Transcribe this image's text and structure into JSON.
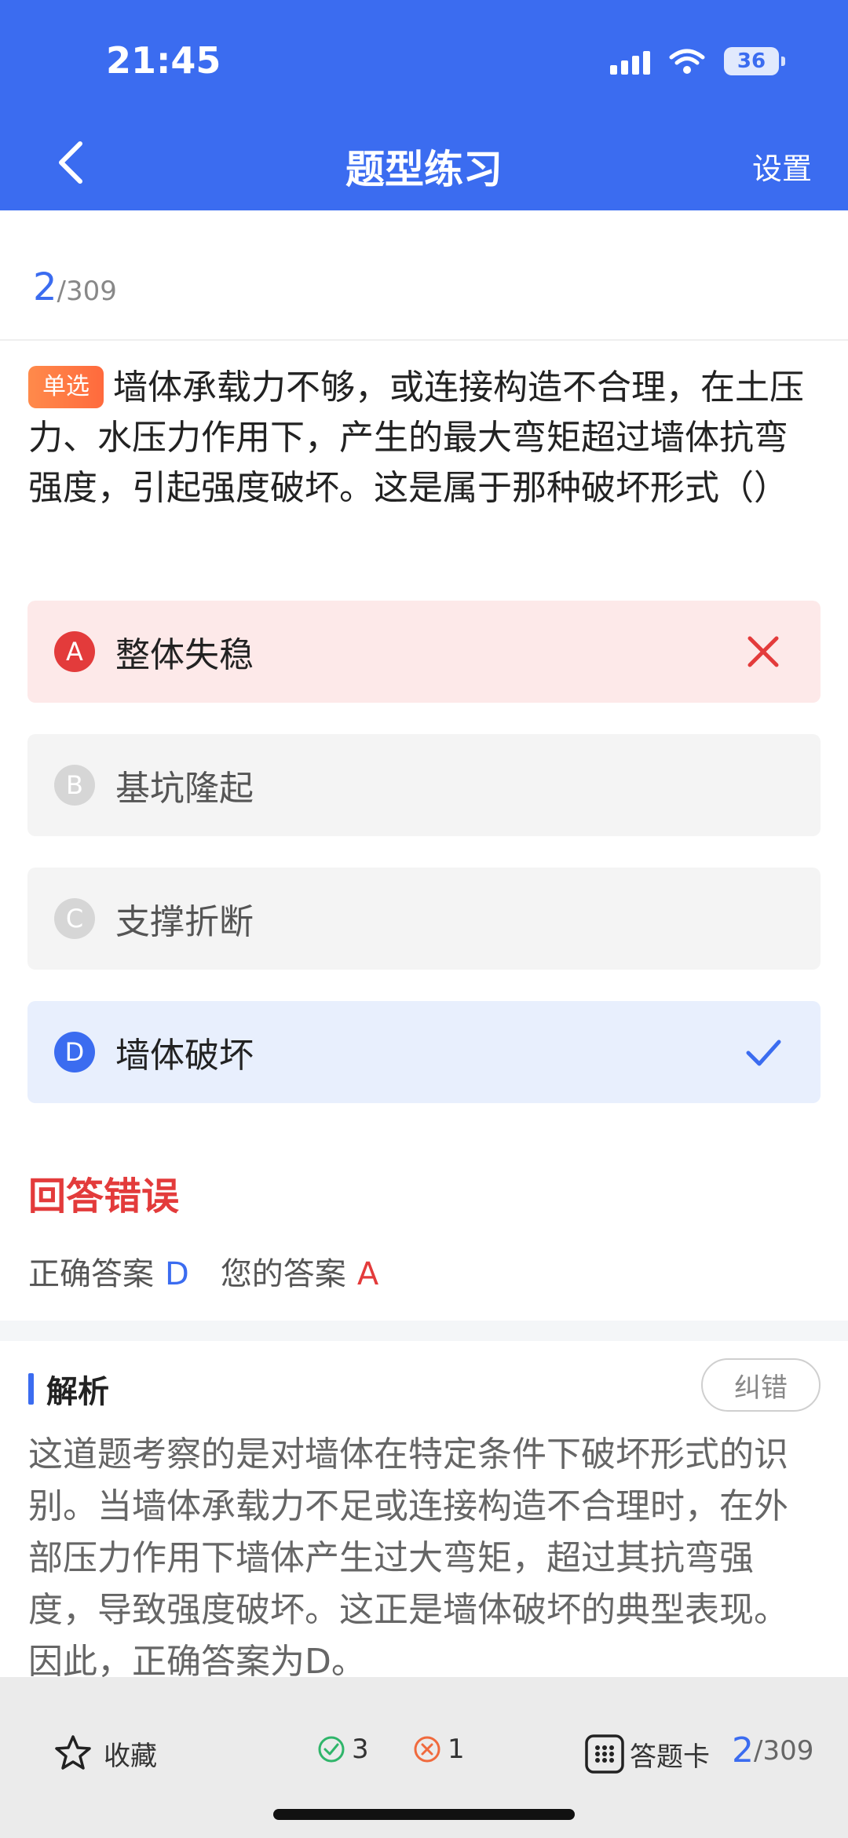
{
  "status": {
    "time": "21:45",
    "battery": "36"
  },
  "header": {
    "title": "题型练习",
    "settings_label": "设置"
  },
  "progress": {
    "current": "2",
    "total": "/309"
  },
  "question": {
    "type_tag": "单选",
    "text": "墙体承载力不够，或连接构造不合理，在土压力、水压力作用下，产生的最大弯矩超过墙体抗弯强度，引起强度破坏。这是属于那种破坏形式（）"
  },
  "options": [
    {
      "letter": "A",
      "text": "整体失稳",
      "state": "wrong"
    },
    {
      "letter": "B",
      "text": "基坑隆起",
      "state": "neutral"
    },
    {
      "letter": "C",
      "text": "支撑折断",
      "state": "neutral"
    },
    {
      "letter": "D",
      "text": "墙体破坏",
      "state": "correct"
    }
  ],
  "result": {
    "title": "回答错误",
    "correct_label": "正确答案",
    "correct_value": "D",
    "yours_label": "您的答案",
    "yours_value": "A"
  },
  "analysis": {
    "title": "解析",
    "report_label": "纠错",
    "text": "这道题考察的是对墙体在特定条件下破坏形式的识别。当墙体承载力不足或连接构造不合理时，在外部压力作用下墙体产生过大弯矩，超过其抗弯强度，导致强度破坏。这正是墙体破坏的典型表现。因此，正确答案为D。"
  },
  "bottom": {
    "favorite_label": "收藏",
    "correct_count": "3",
    "wrong_count": "1",
    "answer_card_label": "答题卡",
    "page_current": "2",
    "page_total": "/309"
  },
  "colors": {
    "primary": "#3b6cf0",
    "error": "#e33b3b",
    "success": "#2fb56a"
  }
}
